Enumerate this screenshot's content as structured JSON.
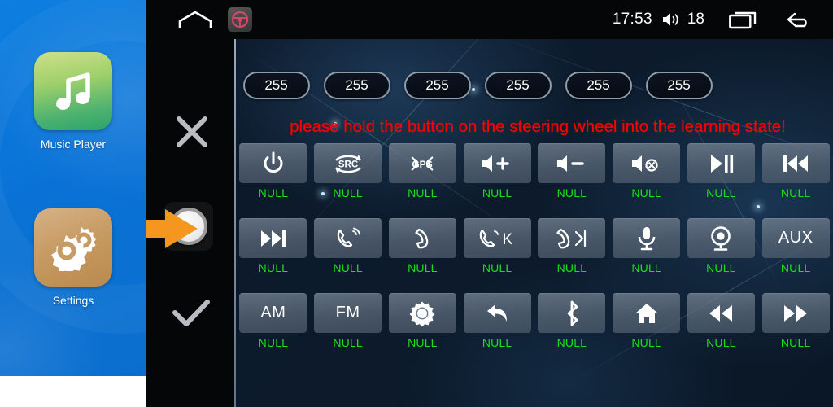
{
  "sidebar": {
    "apps": [
      {
        "label": "Music Player",
        "icon": "music-note-icon"
      },
      {
        "label": "Settings",
        "icon": "gears-icon"
      }
    ]
  },
  "statusbar": {
    "home_icon": "home-icon",
    "steering_wheel_icon": "steering-wheel-icon",
    "time": "17:53",
    "volume_icon": "volume-icon",
    "volume_level": "18",
    "recent_apps_icon": "recent-apps-icon",
    "back_icon": "back-arrow-icon"
  },
  "controls": {
    "cancel_icon": "close-x-icon",
    "knob_icon": "knob-button-icon",
    "confirm_icon": "check-icon",
    "pointer_icon": "orange-arrow-icon"
  },
  "values": {
    "pills": [
      "255",
      "255",
      "255",
      "255",
      "255",
      "255"
    ]
  },
  "warning": {
    "text": "please hold the button on the steering wheel into the learning state!",
    "color": "#fe0000"
  },
  "grid": {
    "null_label": "NULL",
    "label_color": "#18e018",
    "rows": [
      [
        {
          "icon": "power-icon",
          "text": "",
          "label": "NULL"
        },
        {
          "icon": "src-icon",
          "text": "SRC",
          "label": "NULL"
        },
        {
          "icon": "gps-icon",
          "text": "GPS",
          "label": "NULL"
        },
        {
          "icon": "volume-up-icon",
          "text": "",
          "label": "NULL"
        },
        {
          "icon": "volume-down-icon",
          "text": "",
          "label": "NULL"
        },
        {
          "icon": "volume-mute-icon",
          "text": "",
          "label": "NULL"
        },
        {
          "icon": "play-pause-icon",
          "text": "",
          "label": "NULL"
        },
        {
          "icon": "previous-track-icon",
          "text": "",
          "label": "NULL"
        }
      ],
      [
        {
          "icon": "next-track-icon",
          "text": "",
          "label": "NULL"
        },
        {
          "icon": "answer-call-icon",
          "text": "",
          "label": "NULL"
        },
        {
          "icon": "hang-up-icon",
          "text": "",
          "label": "NULL"
        },
        {
          "icon": "call-k-icon",
          "text": "K",
          "label": "NULL"
        },
        {
          "icon": "hang-up-next-icon",
          "text": "",
          "label": "NULL"
        },
        {
          "icon": "microphone-icon",
          "text": "",
          "label": "NULL"
        },
        {
          "icon": "camera-icon",
          "text": "",
          "label": "NULL"
        },
        {
          "icon": "aux-icon",
          "text": "AUX",
          "label": "NULL"
        }
      ],
      [
        {
          "icon": "am-icon",
          "text": "AM",
          "label": "NULL"
        },
        {
          "icon": "fm-icon",
          "text": "FM",
          "label": "NULL"
        },
        {
          "icon": "brightness-icon",
          "text": "",
          "label": "NULL"
        },
        {
          "icon": "back-return-icon",
          "text": "",
          "label": "NULL"
        },
        {
          "icon": "bluetooth-icon",
          "text": "",
          "label": "NULL"
        },
        {
          "icon": "home-icon",
          "text": "",
          "label": "NULL"
        },
        {
          "icon": "rewind-icon",
          "text": "",
          "label": "NULL"
        },
        {
          "icon": "fast-forward-icon",
          "text": "",
          "label": "NULL"
        }
      ]
    ]
  },
  "colors": {
    "sidebar_blue": "#0a72d6",
    "panel_dark": "#0c1b2c",
    "status_black": "#050608",
    "warning_red": "#fe0000",
    "null_green": "#18e018",
    "arrow_orange": "#f5971f"
  }
}
